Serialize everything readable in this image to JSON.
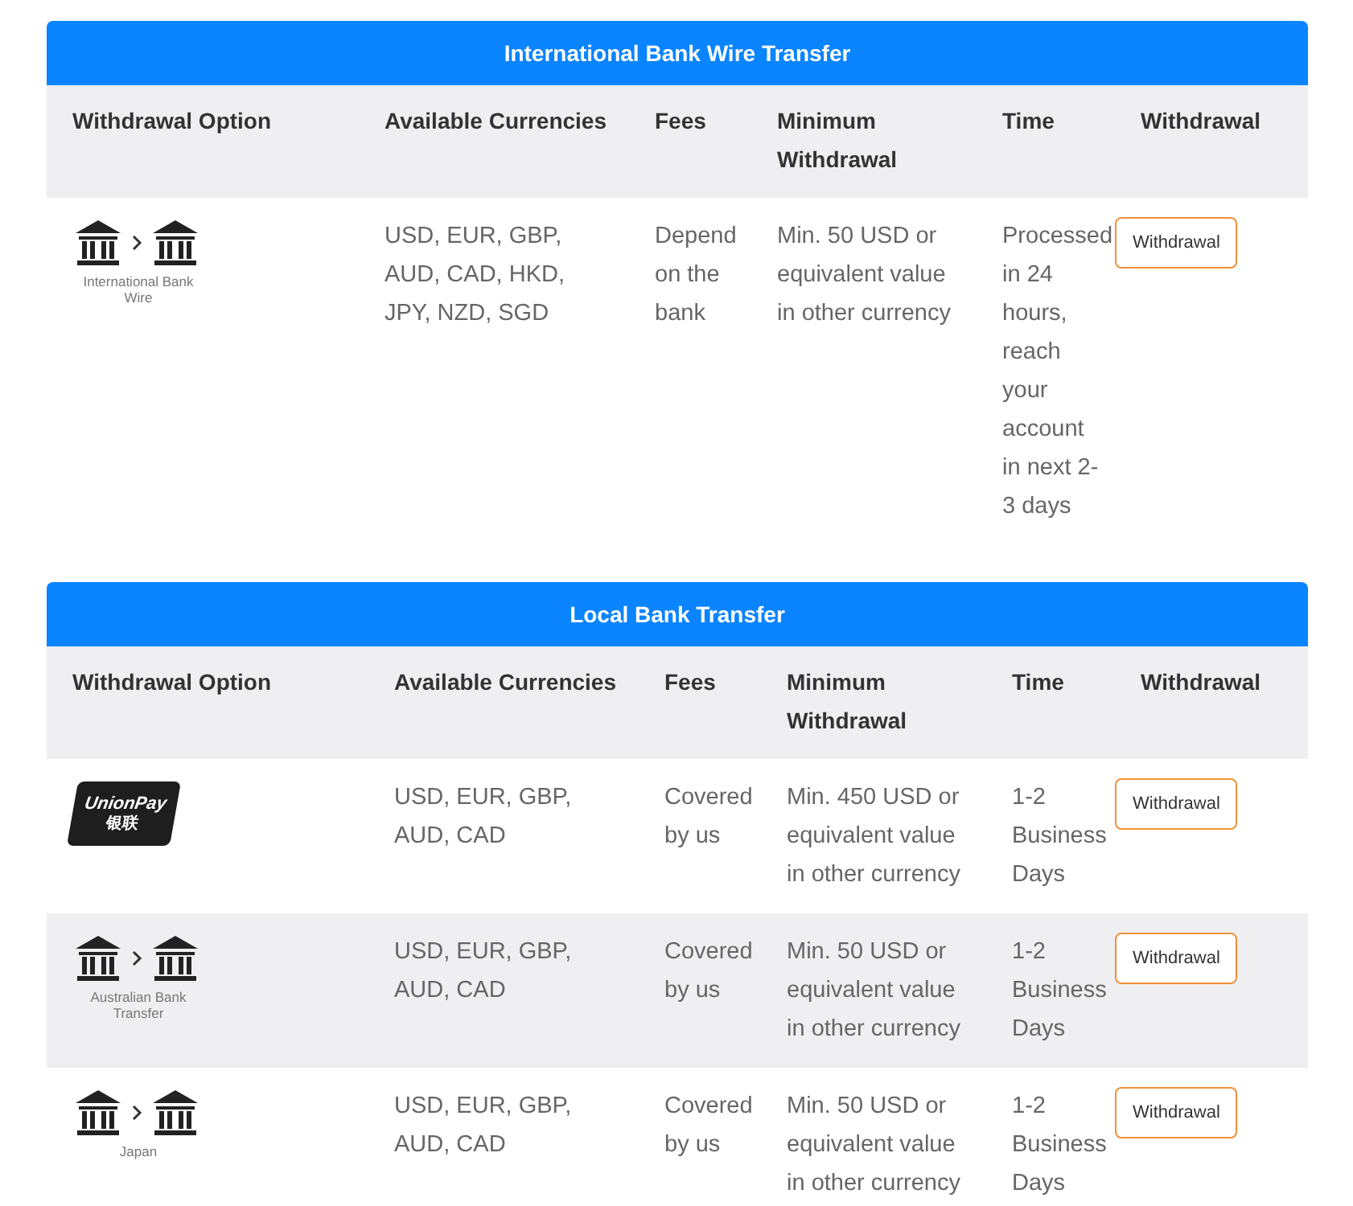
{
  "tables": [
    {
      "title": "International Bank Wire Transfer",
      "columns": [
        "Withdrawal Option",
        "Available Currencies",
        "Fees",
        "Minimum Withdrawal",
        "Time",
        "Withdrawal"
      ],
      "rows": [
        {
          "kind": "bank",
          "caption": "International Bank Wire",
          "currencies": "USD, EUR, GBP, AUD, CAD, HKD, JPY, NZD, SGD",
          "fees": "Depend on the bank",
          "minimum": "Min. 50 USD or equivalent value in other currency",
          "time": "Processed in 24 hours, reach your account in next 2-3 days",
          "button": "Withdrawal"
        }
      ]
    },
    {
      "title": "Local Bank Transfer",
      "columns": [
        "Withdrawal Option",
        "Available Currencies",
        "Fees",
        "Minimum Withdrawal",
        "Time",
        "Withdrawal"
      ],
      "rows": [
        {
          "kind": "unionpay",
          "logo_text": [
            "UnionPay",
            "银联"
          ],
          "currencies": "USD, EUR, GBP, AUD, CAD",
          "fees": "Covered by us",
          "minimum": "Min. 450 USD or equivalent value in other currency",
          "time": "1-2 Business Days",
          "button": "Withdrawal"
        },
        {
          "kind": "bank",
          "caption": "Australian Bank Transfer",
          "currencies": "USD, EUR, GBP, AUD, CAD",
          "fees": "Covered by us",
          "minimum": "Min. 50 USD or equivalent value in other currency",
          "time": "1-2 Business Days",
          "button": "Withdrawal"
        },
        {
          "kind": "bank",
          "caption": "Japan",
          "currencies": "USD, EUR, GBP, AUD, CAD",
          "fees": "Covered by us",
          "minimum": "Min. 50 USD or equivalent value in other currency",
          "time": "1-2 Business Days",
          "button": "Withdrawal"
        }
      ]
    }
  ]
}
